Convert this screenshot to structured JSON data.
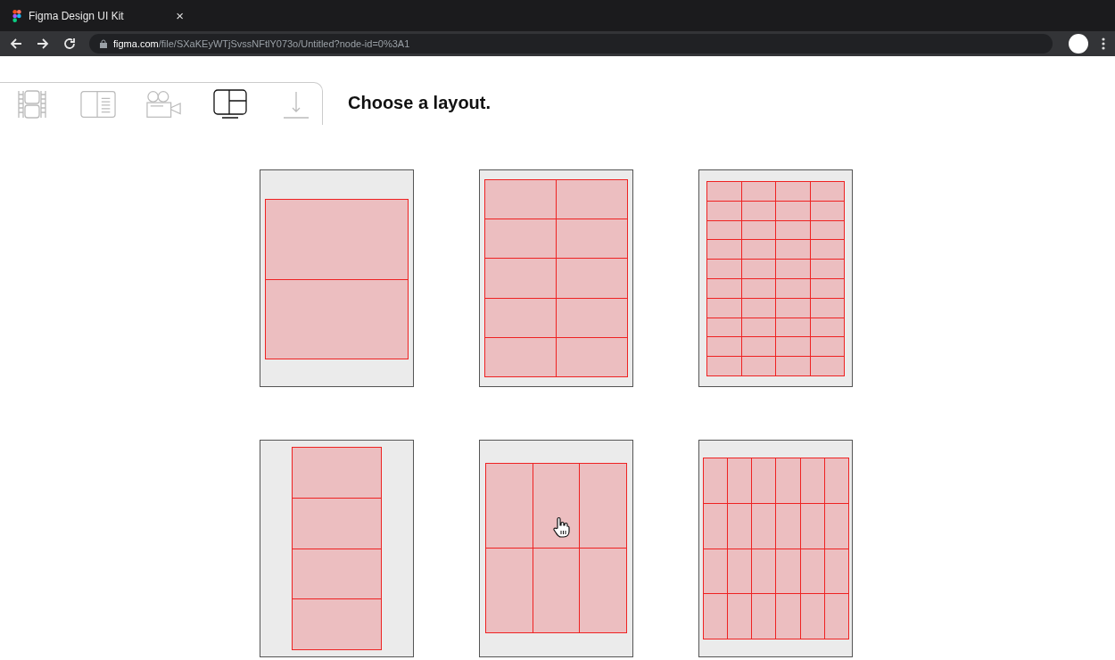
{
  "browser": {
    "tab_title": "Figma Design UI Kit",
    "tab_close": "×",
    "url_host": "figma.com",
    "url_path": "/file/SXaKEyWTjSvssNFtlY073o/Untitled?node-id=0%3A1"
  },
  "toolbar": {
    "tools": [
      {
        "kind": "film",
        "selected": false
      },
      {
        "kind": "reader",
        "selected": false
      },
      {
        "kind": "camera",
        "selected": false
      },
      {
        "kind": "layout",
        "selected": true
      },
      {
        "kind": "download",
        "selected": false
      }
    ]
  },
  "heading": "Choose a layout.",
  "layouts": [
    {
      "kind": "halves"
    },
    {
      "kind": "tenths"
    },
    {
      "kind": "labels"
    },
    {
      "kind": "strip"
    },
    {
      "kind": "sixths",
      "hovered": true
    },
    {
      "kind": "stamps"
    }
  ]
}
